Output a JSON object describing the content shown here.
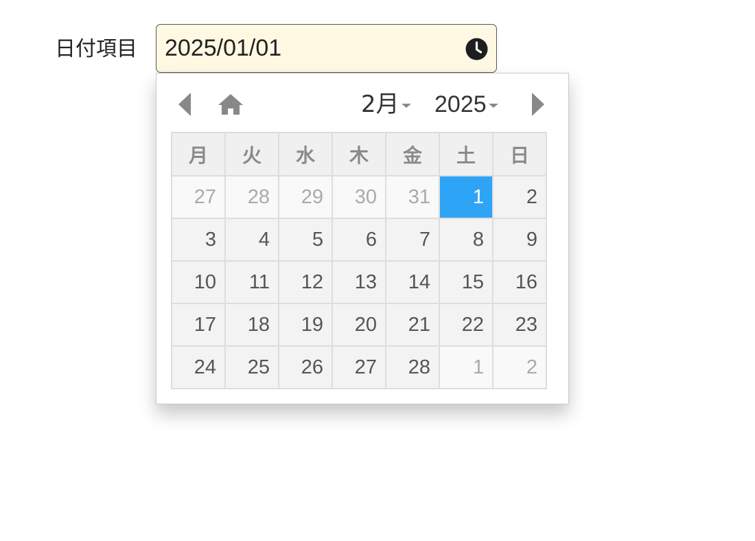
{
  "form": {
    "label": "日付項目",
    "value": "2025/01/01",
    "trailing_icon": "clock-icon"
  },
  "calendar": {
    "month": "2月",
    "year": "2025",
    "nav_icons": [
      "chevron-left-icon",
      "home-icon",
      "chevron-right-icon"
    ],
    "weekdays": [
      "月",
      "火",
      "水",
      "木",
      "金",
      "土",
      "日"
    ],
    "weeks": [
      [
        "27",
        "28",
        "29",
        "30",
        "31",
        "1",
        "2"
      ],
      [
        "3",
        "4",
        "5",
        "6",
        "7",
        "8",
        "9"
      ],
      [
        "10",
        "11",
        "12",
        "13",
        "14",
        "15",
        "16"
      ],
      [
        "17",
        "18",
        "19",
        "20",
        "21",
        "22",
        "23"
      ],
      [
        "24",
        "25",
        "26",
        "27",
        "28",
        "1",
        "2"
      ]
    ],
    "outside_month": [
      [
        0,
        0
      ],
      [
        0,
        1
      ],
      [
        0,
        2
      ],
      [
        0,
        3
      ],
      [
        0,
        4
      ],
      [
        4,
        5
      ],
      [
        4,
        6
      ]
    ],
    "selected": [
      0,
      5
    ],
    "colors": {
      "selected": "#2ea4f7",
      "input_background": "#fff8e3"
    }
  }
}
